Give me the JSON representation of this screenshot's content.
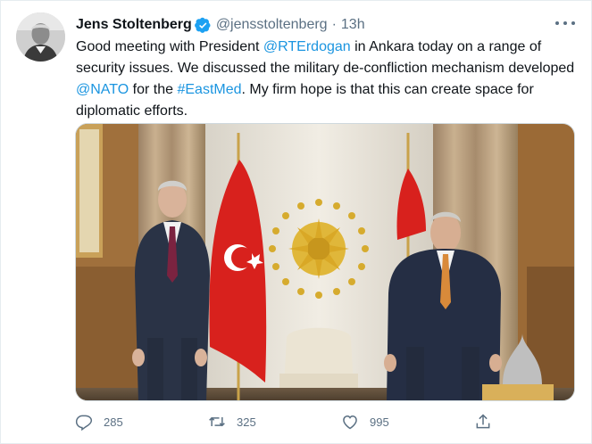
{
  "tweet": {
    "author_name": "Jens Stoltenberg",
    "author_handle": "@jensstoltenberg",
    "separator": "·",
    "time": "13h",
    "text": {
      "t1": "Good meeting with President ",
      "mention1": "@RTErdogan",
      "t2": " in Ankara today on a range of security issues. We discussed the military de-confliction mechanism developed ",
      "mention2": "@NATO",
      "t3": " for the ",
      "hashtag": "#EastMed",
      "t4": ". My firm hope is that this can create space for diplomatic efforts."
    }
  },
  "actions": {
    "reply_count": "285",
    "retweet_count": "325",
    "like_count": "995"
  },
  "colors": {
    "link": "#1b95e0",
    "verified": "#1da1f2",
    "secondary_text": "#5b7083"
  },
  "icons": [
    "verified-badge-icon",
    "more-options-icon",
    "reply-icon",
    "retweet-icon",
    "like-icon",
    "share-icon"
  ]
}
